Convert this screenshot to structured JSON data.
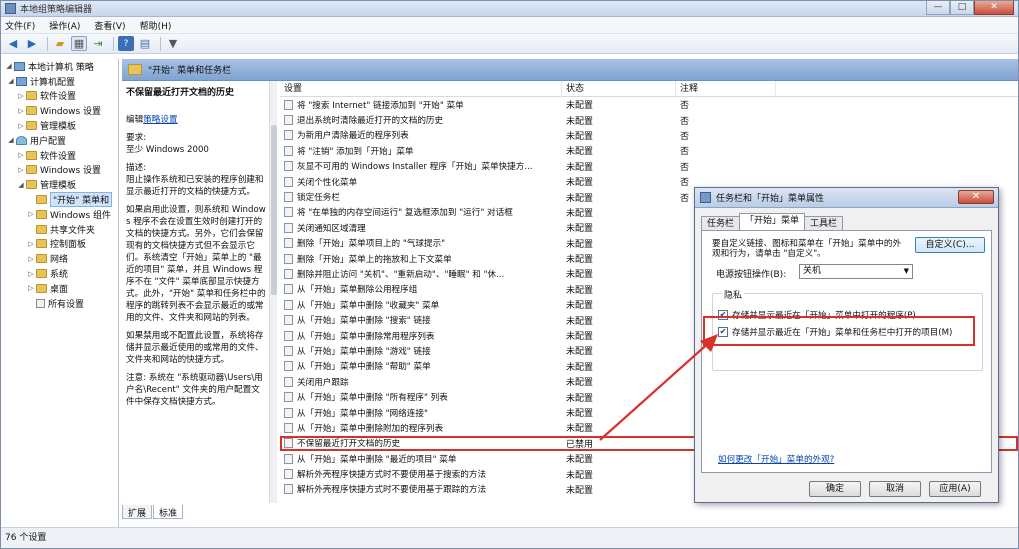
{
  "window": {
    "title": "本地组策略编辑器",
    "controls": [
      "—",
      "□",
      "✕"
    ]
  },
  "menubar": {
    "items": [
      "文件(F)",
      "操作(A)",
      "查看(V)",
      "帮助(H)"
    ]
  },
  "toolbar": {
    "icons": [
      "back-icon",
      "forward-icon",
      "up-folder-icon",
      "show-tree-icon",
      "export-icon",
      "help-icon",
      "view-icon",
      "filter-icon"
    ]
  },
  "tree": {
    "items": [
      {
        "label": "本地计算机 策略",
        "icon": "computer"
      },
      {
        "label": "计算机配置",
        "icon": "computer"
      },
      {
        "label": "软件设置",
        "icon": "folder"
      },
      {
        "label": "Windows 设置",
        "icon": "folder"
      },
      {
        "label": "管理模板",
        "icon": "folder"
      },
      {
        "label": "用户配置",
        "icon": "user"
      },
      {
        "label": "软件设置",
        "icon": "folder"
      },
      {
        "label": "Windows 设置",
        "icon": "folder"
      },
      {
        "label": "管理模板",
        "icon": "folder"
      },
      {
        "label": "\"开始\" 菜单和",
        "icon": "folder"
      },
      {
        "label": "Windows 组件",
        "icon": "folder"
      },
      {
        "label": "共享文件夹",
        "icon": "folder"
      },
      {
        "label": "控制面板",
        "icon": "folder"
      },
      {
        "label": "网络",
        "icon": "folder"
      },
      {
        "label": "系统",
        "icon": "folder"
      },
      {
        "label": "桌面",
        "icon": "folder"
      },
      {
        "label": "所有设置",
        "icon": "page"
      }
    ]
  },
  "right_header": {
    "title": "\"开始\" 菜单和任务栏"
  },
  "description": {
    "title": "不保留最近打开文档的历史",
    "edit_prefix": "编辑",
    "edit_link": "策略设置",
    "requirement_label": "要求:",
    "requirement_value": "至少 Windows 2000",
    "description_label": "描述:",
    "description_text": "阻止操作系统和已安装的程序创建和显示最近打开的文档的快捷方式。",
    "para1": "如果启用此设置，则系统和 Windows 程序不会在设置生效时创建打开的文档的快捷方式。另外，它们会保留现有的文档快捷方式但不会显示它们。系统清空「开始」菜单上的 \"最近的项目\" 菜单，并且 Windows 程序不在 \"文件\" 菜单底部显示快捷方式。此外，\"开始\" 菜单和任务栏中的程序的跳转列表不会显示最近的或常用的文件、文件夹和网站的列表。",
    "para2": "如果禁用或不配置此设置，系统将存储并显示最近使用的或常用的文件、文件夹和网站的快捷方式。",
    "para3": "注意: 系统在 \"系统驱动器\\Users\\用户名\\Recent\" 文件夹的用户配置文件中保存文档快捷方式。"
  },
  "list": {
    "headers": {
      "setting": "设置",
      "state": "状态",
      "note": "注释"
    },
    "rows": [
      {
        "setting": "将 \"搜索 Internet\" 链接添加到 \"开始\" 菜单",
        "state": "未配置",
        "note": "否"
      },
      {
        "setting": "退出系统时清除最近打开的文档的历史",
        "state": "未配置",
        "note": "否"
      },
      {
        "setting": "为新用户清除最近的程序列表",
        "state": "未配置",
        "note": "否"
      },
      {
        "setting": "将 \"注销\" 添加到「开始」菜单",
        "state": "未配置",
        "note": "否"
      },
      {
        "setting": "灰显不可用的 Windows Installer 程序「开始」菜单快捷方...",
        "state": "未配置",
        "note": "否"
      },
      {
        "setting": "关闭个性化菜单",
        "state": "未配置",
        "note": "否"
      },
      {
        "setting": "锁定任务栏",
        "state": "未配置",
        "note": "否"
      },
      {
        "setting": "将 \"在单独的内存空间运行\" 复选框添加到 \"运行\" 对话框",
        "state": "未配置",
        "note": ""
      },
      {
        "setting": "关闭通知区域清理",
        "state": "未配置",
        "note": ""
      },
      {
        "setting": "删除「开始」菜单项目上的 \"气球提示\"",
        "state": "未配置",
        "note": ""
      },
      {
        "setting": "删除「开始」菜单上的拖放和上下文菜单",
        "state": "未配置",
        "note": ""
      },
      {
        "setting": "删除并阻止访问 \"关机\"、\"重新启动\"、\"睡眠\" 和 \"休...",
        "state": "未配置",
        "note": ""
      },
      {
        "setting": "从「开始」菜单删除公用程序组",
        "state": "未配置",
        "note": ""
      },
      {
        "setting": "从「开始」菜单中删除 \"收藏夹\" 菜单",
        "state": "未配置",
        "note": ""
      },
      {
        "setting": "从「开始」菜单中删除 \"搜索\" 链接",
        "state": "未配置",
        "note": ""
      },
      {
        "setting": "从「开始」菜单中删除常用程序列表",
        "state": "未配置",
        "note": ""
      },
      {
        "setting": "从「开始」菜单中删除 \"游戏\" 链接",
        "state": "未配置",
        "note": ""
      },
      {
        "setting": "从「开始」菜单中删除 \"帮助\" 菜单",
        "state": "未配置",
        "note": ""
      },
      {
        "setting": "关闭用户跟踪",
        "state": "未配置",
        "note": ""
      },
      {
        "setting": "从「开始」菜单中删除 \"所有程序\" 列表",
        "state": "未配置",
        "note": ""
      },
      {
        "setting": "从「开始」菜单中删除 \"网络连接\"",
        "state": "未配置",
        "note": ""
      },
      {
        "setting": "从「开始」菜单中删除附加的程序列表",
        "state": "未配置",
        "note": ""
      },
      {
        "setting": "不保留最近打开文档的历史",
        "state": "已禁用",
        "note": ""
      },
      {
        "setting": "从「开始」菜单中删除 \"最近的项目\" 菜单",
        "state": "未配置",
        "note": ""
      },
      {
        "setting": "解析外壳程序快捷方式时不要使用基于搜索的方法",
        "state": "未配置",
        "note": ""
      },
      {
        "setting": "解析外壳程序快捷方式时不要使用基于跟踪的方法",
        "state": "未配置",
        "note": ""
      }
    ]
  },
  "bottom_tabs": [
    "扩展",
    "标准"
  ],
  "statusbar": {
    "text": "76 个设置"
  },
  "dialog": {
    "title": "任务栏和「开始」菜单属性",
    "tabs": [
      "任务栏",
      "「开始」菜单",
      "工具栏"
    ],
    "intro": "要自定义链接、图标和菜单在「开始」菜单中的外观和行为，请单击 \"自定义\"。",
    "customize_button": "自定义(C)...",
    "power_label": "电源按钮操作(B):",
    "power_value": "关机",
    "privacy_label": "隐私",
    "checkbox1": "存储并显示最近在「开始」菜单中打开的程序(P)",
    "checkbox2": "存储并显示最近在「开始」菜单和任务栏中打开的项目(M)",
    "checkbox1_checked": true,
    "checkbox2_checked": true,
    "appearance_link": "如何更改「开始」菜单的外观?",
    "ok_button": "确定",
    "cancel_button": "取消",
    "apply_button": "应用(A)"
  },
  "colors": {
    "highlight": "#d9302a",
    "header_blue": "#8fb0da",
    "link": "#0645ad"
  }
}
